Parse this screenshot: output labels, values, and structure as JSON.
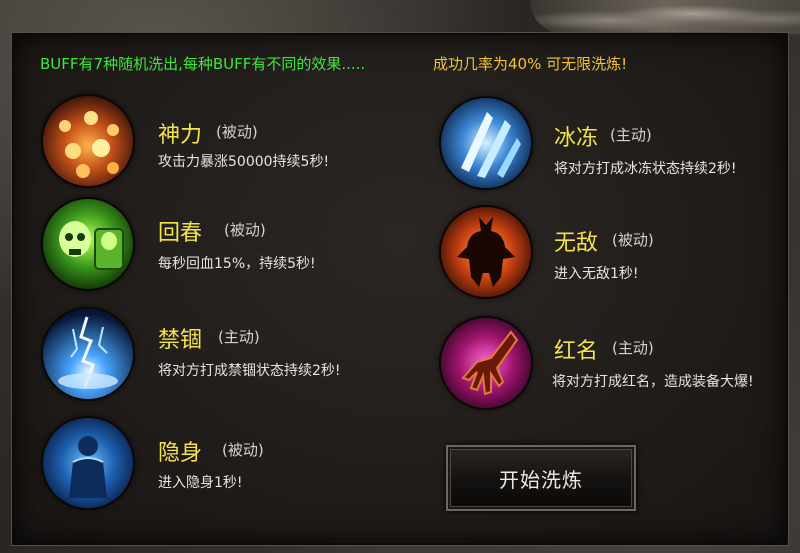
{
  "banner": {
    "info": "BUFF有7种随机洗出,每种BUFF有不同的效果.....",
    "rate": "成功几率为40%  可无限洗炼!"
  },
  "skills_left": [
    {
      "name": "神力",
      "type": "(被动)",
      "desc": "攻击力暴涨50000持续5秒!",
      "icon": "flame-candles-icon"
    },
    {
      "name": "回春",
      "type": "(被动)",
      "desc": "每秒回血15%，持续5秒!",
      "icon": "green-skull-icon"
    },
    {
      "name": "禁锢",
      "type": "(主动)",
      "desc": "将对方打成禁锢状态持续2秒!",
      "icon": "lightning-icon"
    },
    {
      "name": "隐身",
      "type": "(被动)",
      "desc": "进入隐身1秒!",
      "icon": "ghost-figure-icon"
    }
  ],
  "skills_right": [
    {
      "name": "冰冻",
      "type": "(主动)",
      "desc": "将对方打成冰冻状态持续2秒!",
      "icon": "ice-shards-icon"
    },
    {
      "name": "无敌",
      "type": "(被动)",
      "desc": "进入无敌1秒!",
      "icon": "demon-silhouette-icon"
    },
    {
      "name": "红名",
      "type": "(主动)",
      "desc": "将对方打成红名，造成装备大爆!",
      "icon": "claw-hand-icon"
    }
  ],
  "start_button": {
    "label": "开始洗炼"
  },
  "colors": {
    "banner_info": "#3ee63e",
    "banner_rate": "#f0c23a",
    "skill_name": "#f2e34a"
  }
}
